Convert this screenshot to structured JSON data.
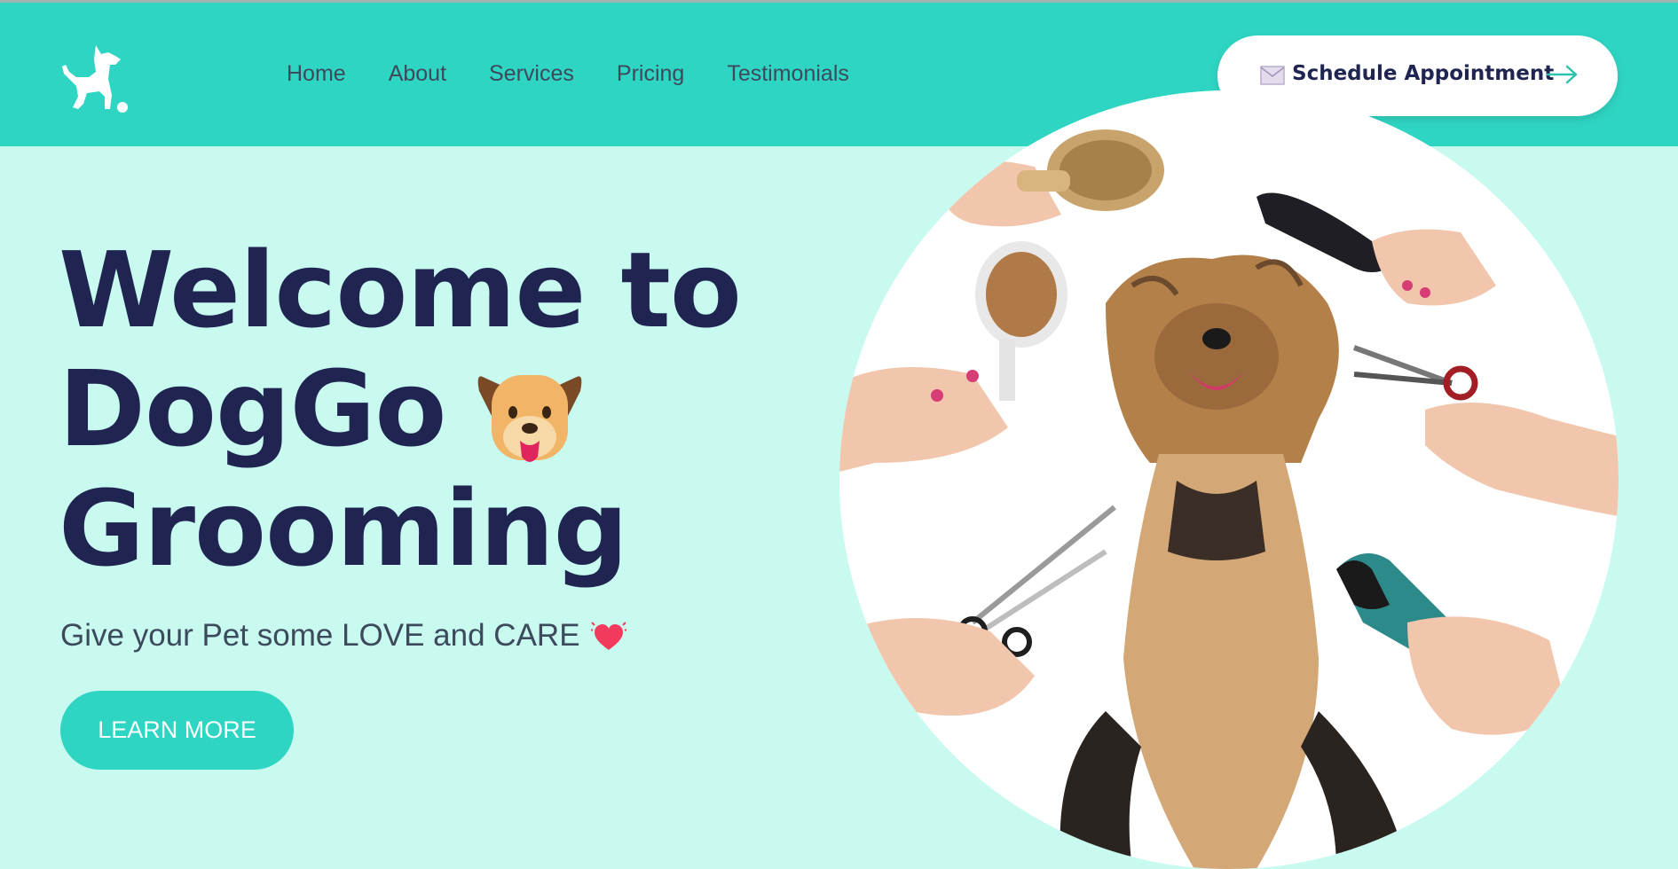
{
  "nav": {
    "items": [
      "Home",
      "About",
      "Services",
      "Pricing",
      "Testimonials"
    ]
  },
  "header": {
    "logo_icon": "dog-icon",
    "cta_label": "Schedule Appointment",
    "cta_icon": "mail-icon",
    "cta_arrow_icon": "arrow-right-icon"
  },
  "hero": {
    "title_line1": "Welcome to",
    "title_line2": "DogGo",
    "title_line3": "Grooming",
    "title_emoji": "dog-face-icon",
    "tagline": "Give your Pet some LOVE and CARE",
    "tagline_emoji": "heart-icon",
    "button_label": "LEARN MORE",
    "image": "dog-grooming-photo"
  },
  "colors": {
    "header_bg": "#2fd5c3",
    "page_bg": "#c8faf0",
    "title": "#1f2450",
    "nav_text": "#3c4a5c",
    "accent": "#2fd5c3"
  }
}
